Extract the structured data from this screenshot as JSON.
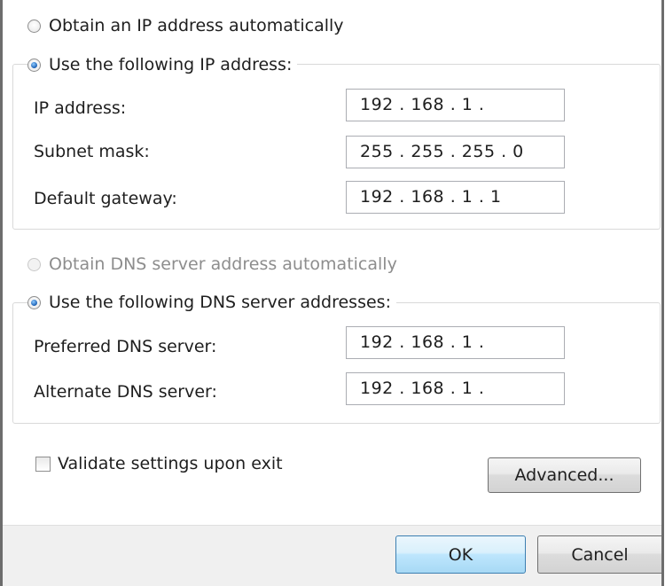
{
  "ip_section": {
    "obtain_auto_label": "Obtain an IP address automatically",
    "use_following_label": "Use the following IP address:",
    "fields": [
      {
        "label": "IP address:",
        "value": "192 . 168 .  1  ."
      },
      {
        "label": "Subnet mask:",
        "value": "255 . 255 . 255 .  0"
      },
      {
        "label": "Default gateway:",
        "value": "192 . 168 .  1  .  1"
      }
    ]
  },
  "dns_section": {
    "obtain_auto_label": "Obtain DNS server address automatically",
    "use_following_label": "Use the following DNS server addresses:",
    "fields": [
      {
        "label": "Preferred DNS server:",
        "value": "192 . 168 .  1  ."
      },
      {
        "label": "Alternate DNS server:",
        "value": "192 . 168 .  1  ."
      }
    ]
  },
  "validate_label": "Validate settings upon exit",
  "buttons": {
    "advanced": "Advanced...",
    "ok": "OK",
    "cancel": "Cancel"
  }
}
